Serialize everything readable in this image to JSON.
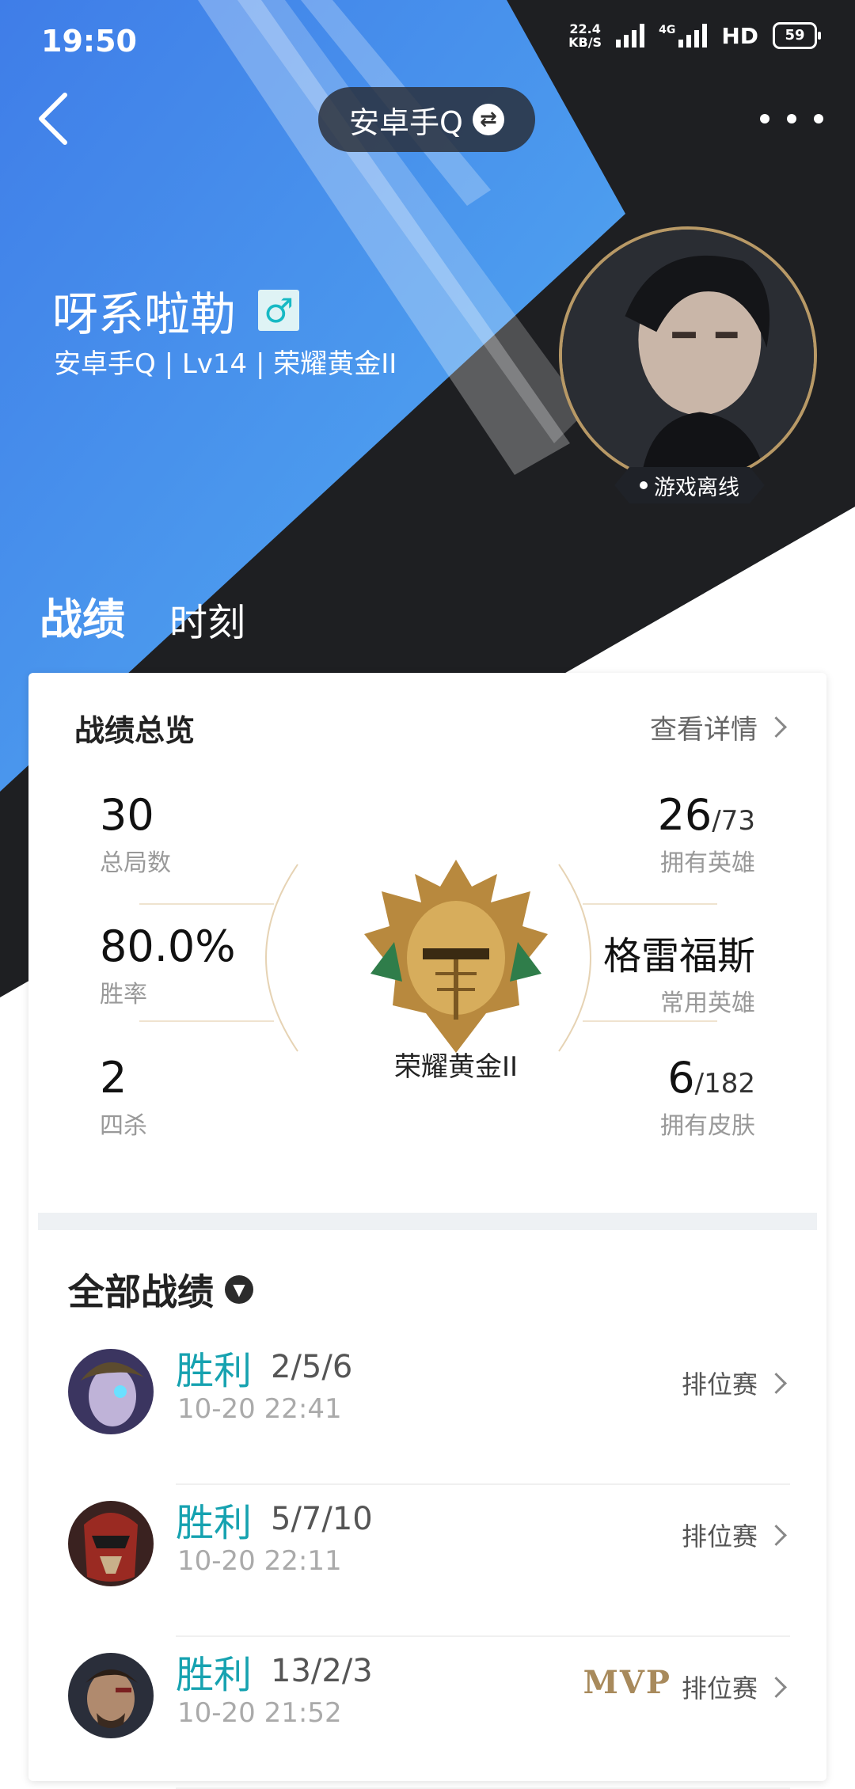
{
  "status_bar": {
    "time": "19:50",
    "net_speed_value": "22.4",
    "net_speed_unit": "KB/S",
    "network_type": "4G",
    "hd_label": "HD",
    "battery": "59"
  },
  "header": {
    "account_switch": "安卓手Q"
  },
  "profile": {
    "nickname": "呀系啦勒",
    "gender_symbol": "♂",
    "subinfo": "安卓手Q | Lv14 | 荣耀黄金II",
    "online_status": "游戏离线"
  },
  "tabs": [
    {
      "label": "战绩",
      "active": true
    },
    {
      "label": "时刻",
      "active": false
    }
  ],
  "overview": {
    "title": "战绩总览",
    "detail_link": "查看详情",
    "total_games": {
      "value": "30",
      "label": "总局数"
    },
    "win_rate": {
      "value": "80.0%",
      "label": "胜率"
    },
    "quadra_kills": {
      "value": "2",
      "label": "四杀"
    },
    "heroes": {
      "value": "26",
      "total": "/73",
      "label": "拥有英雄"
    },
    "common_hero": {
      "value": "格雷福斯",
      "label": "常用英雄"
    },
    "skins": {
      "value": "6",
      "total": "/182",
      "label": "拥有皮肤"
    },
    "rank": "荣耀黄金II"
  },
  "all_matches": {
    "title": "全部战绩",
    "items": [
      {
        "result": "胜利",
        "kda": "2/5/6",
        "time": "10-20 22:41",
        "type": "排位赛",
        "mvp": ""
      },
      {
        "result": "胜利",
        "kda": "5/7/10",
        "time": "10-20 22:11",
        "type": "排位赛",
        "mvp": ""
      },
      {
        "result": "胜利",
        "kda": "13/2/3",
        "time": "10-20 21:52",
        "type": "排位赛",
        "mvp": "MVP"
      }
    ]
  },
  "colors": {
    "hero_blue": "#3a7be6",
    "hero_dark": "#1e1f22",
    "win_teal": "#16a2b0",
    "mvp_gold": "#a88a5c"
  }
}
